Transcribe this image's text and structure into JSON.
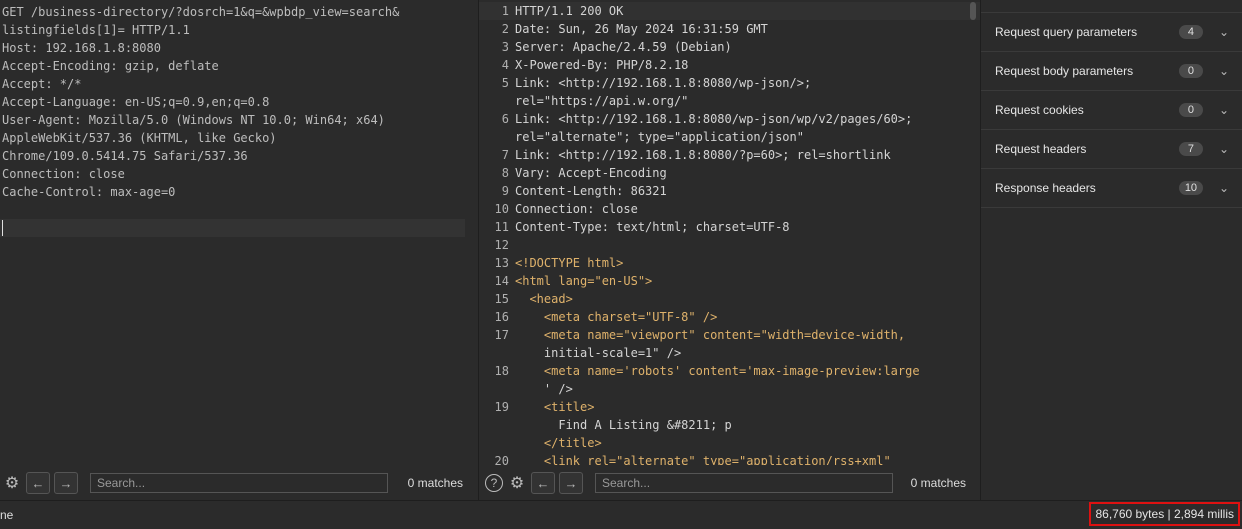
{
  "request": {
    "lines": [
      "GET /business-directory/?dosrch=1&q=&wpbdp_view=search&",
      "listingfields[1]= HTTP/1.1",
      "Host: 192.168.1.8:8080",
      "Accept-Encoding: gzip, deflate",
      "Accept: */*",
      "Accept-Language: en-US;q=0.9,en;q=0.8",
      "User-Agent: Mozilla/5.0 (Windows NT 10.0; Win64; x64)",
      "AppleWebKit/537.36 (KHTML, like Gecko)",
      "Chrome/109.0.5414.75 Safari/537.36",
      "Connection: close",
      "Cache-Control: max-age=0",
      "",
      ""
    ],
    "search_placeholder": "Search...",
    "matches": "0 matches"
  },
  "response": {
    "rows": [
      {
        "n": "1",
        "t": "HTTP/1.1 200 OK"
      },
      {
        "n": "2",
        "t": "Date: Sun, 26 May 2024 16:31:59 GMT"
      },
      {
        "n": "3",
        "t": "Server: Apache/2.4.59 (Debian)"
      },
      {
        "n": "4",
        "t": "X-Powered-By: PHP/8.2.18"
      },
      {
        "n": "5",
        "t": "Link: <http://192.168.1.8:8080/wp-json/>;"
      },
      {
        "n": "",
        "t": "rel=\"https://api.w.org/\""
      },
      {
        "n": "6",
        "t": "Link: <http://192.168.1.8:8080/wp-json/wp/v2/pages/60>;"
      },
      {
        "n": "",
        "t": "rel=\"alternate\"; type=\"application/json\""
      },
      {
        "n": "7",
        "t": "Link: <http://192.168.1.8:8080/?p=60>; rel=shortlink"
      },
      {
        "n": "8",
        "t": "Vary: Accept-Encoding"
      },
      {
        "n": "9",
        "t": "Content-Length: 86321"
      },
      {
        "n": "10",
        "t": "Connection: close"
      },
      {
        "n": "11",
        "t": "Content-Type: text/html; charset=UTF-8"
      },
      {
        "n": "12",
        "t": ""
      },
      {
        "n": "13",
        "t": "<!DOCTYPE html>"
      },
      {
        "n": "14",
        "t": "<html lang=\"en-US\">"
      },
      {
        "n": "15",
        "t": "  <head>"
      },
      {
        "n": "16",
        "t": "    <meta charset=\"UTF-8\" />"
      },
      {
        "n": "17",
        "t": "    <meta name=\"viewport\" content=\"width=device-width,"
      },
      {
        "n": "",
        "t": "    initial-scale=1\" />"
      },
      {
        "n": "18",
        "t": "    <meta name='robots' content='max-image-preview:large"
      },
      {
        "n": "",
        "t": "    ' />"
      },
      {
        "n": "19",
        "t": "    <title>"
      },
      {
        "n": "",
        "t": "      Find A Listing &#8211; p"
      },
      {
        "n": "",
        "t": "    </title>"
      },
      {
        "n": "20",
        "t": "    <link rel=\"alternate\" type=\"application/rss+xml\""
      }
    ],
    "search_placeholder": "Search...",
    "matches": "0 matches"
  },
  "inspector": {
    "items": [
      {
        "label": "Request query parameters",
        "count": "4"
      },
      {
        "label": "Request body parameters",
        "count": "0"
      },
      {
        "label": "Request cookies",
        "count": "0"
      },
      {
        "label": "Request headers",
        "count": "7"
      },
      {
        "label": "Response headers",
        "count": "10"
      }
    ]
  },
  "status": {
    "left": "ne",
    "right": "86,760 bytes | 2,894 millis"
  },
  "icons": {
    "settings": "gear-icon",
    "help": "help-icon",
    "prev": "arrow-left-icon",
    "next": "arrow-right-icon",
    "expand": "chevron-down-icon"
  },
  "colors": {
    "highlight_box": "#dd1111"
  }
}
